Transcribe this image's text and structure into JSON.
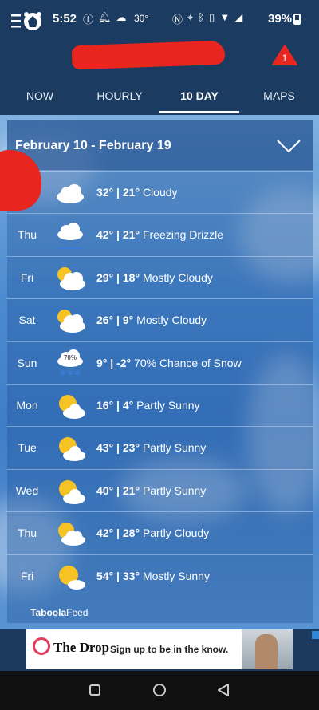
{
  "status_bar": {
    "time": "5:52",
    "temp": "30°",
    "battery": "39%",
    "icons_left": [
      "facebook-icon",
      "bell-icon",
      "cloud-upload-icon"
    ],
    "icons_right": [
      "nfc-icon",
      "location-icon",
      "bluetooth-icon",
      "vibrate-icon",
      "wifi-icon",
      "signal-icon"
    ]
  },
  "header": {
    "alert_count": "1"
  },
  "tabs": [
    {
      "label": "NOW",
      "active": false
    },
    {
      "label": "HOURLY",
      "active": false
    },
    {
      "label": "10 DAY",
      "active": true
    },
    {
      "label": "MAPS",
      "active": false
    }
  ],
  "forecast": {
    "range_title": "February 10 - February 19",
    "days": [
      {
        "day": "",
        "high": "32°",
        "low": "21°",
        "condition": "Cloudy",
        "icon": "cloudy-icon"
      },
      {
        "day": "Thu",
        "high": "42°",
        "low": "21°",
        "condition": "Freezing Drizzle",
        "icon": "freezing-drizzle-icon"
      },
      {
        "day": "Fri",
        "high": "29°",
        "low": "18°",
        "condition": "Mostly Cloudy",
        "icon": "mostly-cloudy-icon"
      },
      {
        "day": "Sat",
        "high": "26°",
        "low": "9°",
        "condition": "Mostly Cloudy",
        "icon": "mostly-cloudy-icon"
      },
      {
        "day": "Sun",
        "high": "9°",
        "low": "-2°",
        "condition": "70% Chance of Snow",
        "icon": "snow-icon",
        "icon_badge": "70%"
      },
      {
        "day": "Mon",
        "high": "16°",
        "low": "4°",
        "condition": "Partly Sunny",
        "icon": "partly-sunny-icon"
      },
      {
        "day": "Tue",
        "high": "43°",
        "low": "23°",
        "condition": "Partly Sunny",
        "icon": "partly-sunny-icon"
      },
      {
        "day": "Wed",
        "high": "40°",
        "low": "21°",
        "condition": "Partly Sunny",
        "icon": "partly-sunny-icon"
      },
      {
        "day": "Thu",
        "high": "42°",
        "low": "28°",
        "condition": "Partly Cloudy",
        "icon": "partly-cloudy-icon"
      },
      {
        "day": "Fri",
        "high": "54°",
        "low": "33°",
        "condition": "Mostly Sunny",
        "icon": "mostly-sunny-icon"
      }
    ]
  },
  "taboola": {
    "brand": "Taboola",
    "suffix": "Feed"
  },
  "ad": {
    "brand": "The Drop",
    "text": "Sign up to be in the know."
  },
  "colors": {
    "header_bg": "#1b3b61",
    "alert_red": "#e8251f",
    "sun": "#f6c324"
  }
}
